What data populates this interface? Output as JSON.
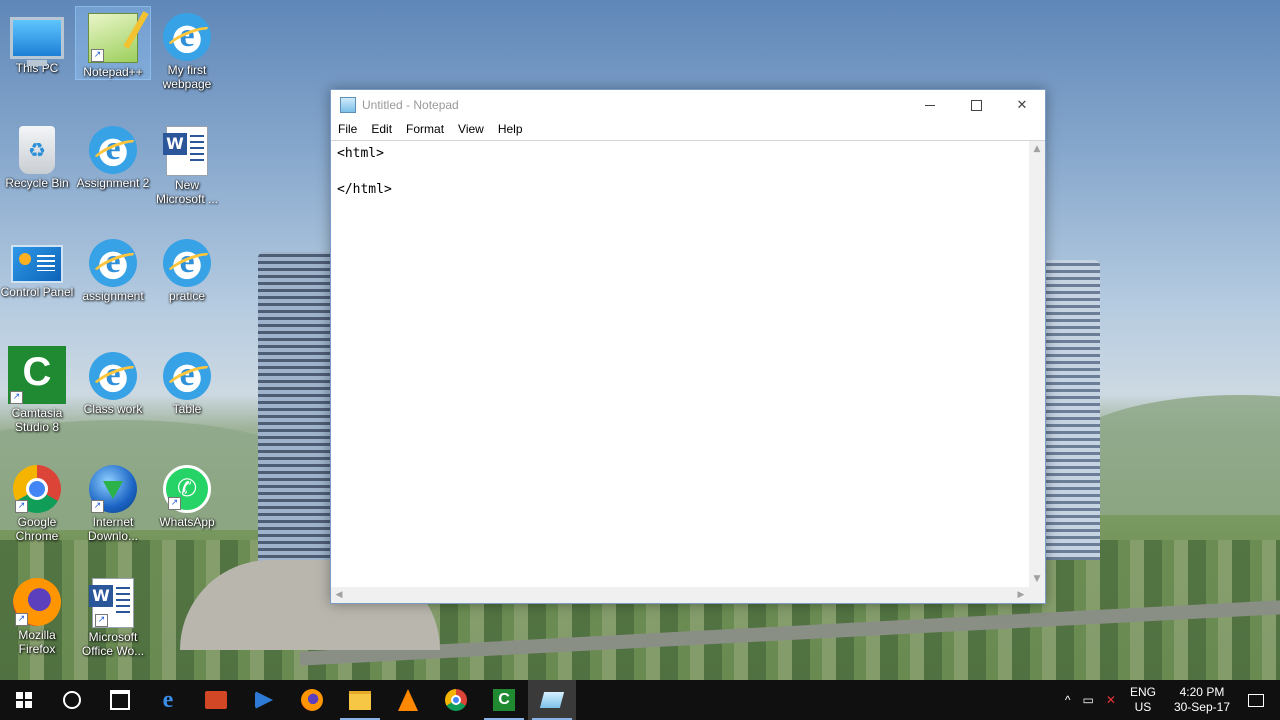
{
  "desktop_icons": [
    {
      "label": "This PC",
      "icon": "this-pc-icon"
    },
    {
      "label": "Notepad++",
      "icon": "notepad-plus-plus-icon"
    },
    {
      "label": "My first webpage",
      "icon": "internet-explorer-icon"
    },
    {
      "label": "Recycle Bin",
      "icon": "recycle-bin-icon"
    },
    {
      "label": "Assignment 2",
      "icon": "internet-explorer-icon"
    },
    {
      "label": "New Microsoft ...",
      "icon": "word-document-icon"
    },
    {
      "label": "Control Panel",
      "icon": "control-panel-icon"
    },
    {
      "label": "assignment",
      "icon": "internet-explorer-icon"
    },
    {
      "label": "pratice",
      "icon": "internet-explorer-icon"
    },
    {
      "label": "Camtasia Studio 8",
      "icon": "camtasia-icon"
    },
    {
      "label": "Class work",
      "icon": "internet-explorer-icon"
    },
    {
      "label": "Table",
      "icon": "internet-explorer-icon"
    },
    {
      "label": "Google Chrome",
      "icon": "chrome-icon"
    },
    {
      "label": "Internet Downlo...",
      "icon": "internet-download-manager-icon"
    },
    {
      "label": "WhatsApp",
      "icon": "whatsapp-icon"
    },
    {
      "label": "Mozilla Firefox",
      "icon": "firefox-icon"
    },
    {
      "label": "Microsoft Office Wo...",
      "icon": "word-icon"
    }
  ],
  "notepad": {
    "title": "Untitled - Notepad",
    "menu": [
      "File",
      "Edit",
      "Format",
      "View",
      "Help"
    ],
    "content": "<html>\n\n</html>"
  },
  "taskbar": {
    "pinned": [
      "start-icon",
      "cortana-icon",
      "store-icon",
      "edge-icon",
      "powerpoint-icon",
      "media-player-icon",
      "firefox-icon",
      "file-explorer-icon",
      "vlc-icon",
      "chrome-icon",
      "camtasia-icon",
      "notepad-icon"
    ],
    "lang_top": "ENG",
    "lang_bottom": "US",
    "time": "4:20 PM",
    "date": "30-Sep-17"
  },
  "colors": {
    "taskbar": "#101010",
    "window_border": "#7a9cc6",
    "accent": "#8ab4e8"
  }
}
